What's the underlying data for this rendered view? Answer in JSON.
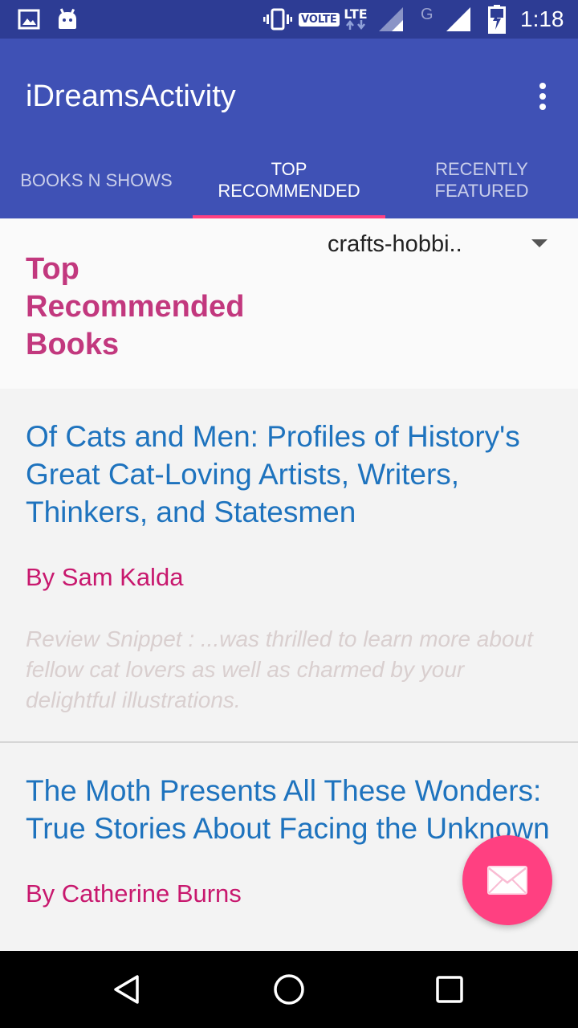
{
  "status_bar": {
    "time": "1:18",
    "volte_label": "VOLTE",
    "lte_label": "LTE",
    "network_g_label": "G",
    "icons": [
      "gallery-icon",
      "android-icon",
      "vibrate-icon",
      "volte-icon",
      "lte-icon",
      "signal-icon",
      "signal-icon",
      "battery-charging-icon"
    ]
  },
  "app_bar": {
    "title": "iDreamsActivity",
    "menu_icon": "more-vert-icon"
  },
  "tabs": [
    {
      "label": "BOOKS N SHOWS",
      "active": false
    },
    {
      "label": "TOP RECOMMENDED",
      "active": true
    },
    {
      "label": "RECENTLY FEATURED",
      "active": false
    }
  ],
  "header": {
    "title": "Top Recommended Books",
    "spinner_value": "crafts-hobbi.."
  },
  "books": [
    {
      "title": "Of Cats and Men: Profiles of History's Great Cat-Loving Artists, Writers, Thinkers, and Statesmen",
      "author": "By Sam Kalda",
      "snippet": "Review Snippet : ...was thrilled to learn more about fellow cat lovers as well as charmed by your delightful illustrations."
    },
    {
      "title": "The Moth Presents All These Wonders: True Stories About Facing the Unknown",
      "author": "By Catherine Burns",
      "snippet": ""
    }
  ],
  "fab": {
    "icon": "email-icon"
  },
  "nav_bar": {
    "icons": [
      "back-icon",
      "home-icon",
      "recents-icon"
    ]
  },
  "colors": {
    "status_bar": "#2d3c94",
    "primary": "#3f51b5",
    "accent": "#ff4081",
    "section_title": "#c2387e",
    "book_title": "#1e73be",
    "author": "#c8186e",
    "snippet": "#d9cfcf"
  }
}
